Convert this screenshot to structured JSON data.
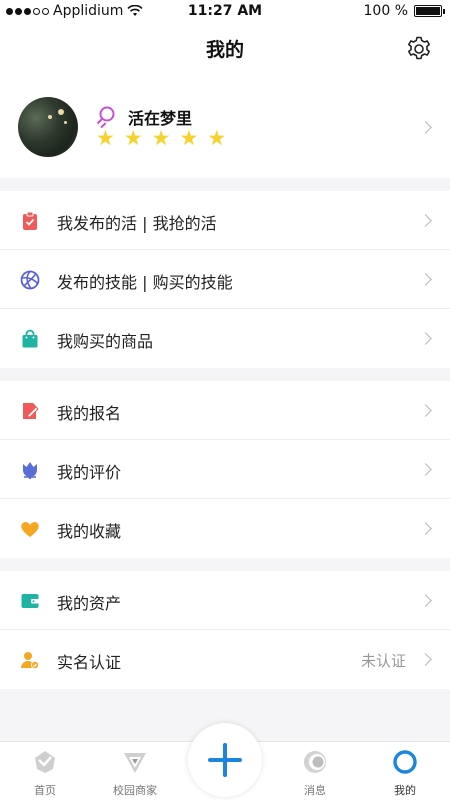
{
  "status_bar": {
    "carrier": "Applidium",
    "time": "11:27 AM",
    "battery": "100 %"
  },
  "header": {
    "title": "我的"
  },
  "profile": {
    "username": "活在梦里",
    "rating": 5,
    "stars": [
      "★",
      "★",
      "★",
      "★",
      "★"
    ]
  },
  "groups": [
    {
      "items": [
        {
          "label": "我发布的活 | 我抢的活",
          "icon": "clipboard-check-icon",
          "color": "#f05a5a"
        },
        {
          "label": "发布的技能 | 购买的技能",
          "icon": "volleyball-icon",
          "color": "#5a5fd6"
        },
        {
          "label": "我购买的商品",
          "icon": "shopping-bag-icon",
          "color": "#1fb3a4"
        }
      ]
    },
    {
      "items": [
        {
          "label": "我的报名",
          "icon": "signup-form-icon",
          "color": "#f05a5a"
        },
        {
          "label": "我的评价",
          "icon": "tulip-icon",
          "color": "#5a6fd6"
        },
        {
          "label": "我的收藏",
          "icon": "heart-icon",
          "color": "#f6a623"
        }
      ]
    },
    {
      "items": [
        {
          "label": "我的资产",
          "icon": "wallet-icon",
          "color": "#1fb3a4"
        },
        {
          "label": "实名认证",
          "icon": "user-verified-icon",
          "color": "#f6a623",
          "status": "未认证"
        }
      ]
    }
  ],
  "tabbar": {
    "tabs": [
      {
        "label": "首页",
        "icon": "home-pin-icon"
      },
      {
        "label": "校园商家",
        "icon": "merchant-logo-icon"
      },
      {
        "label": "",
        "icon": "plus-icon"
      },
      {
        "label": "消息",
        "icon": "message-icon"
      },
      {
        "label": "我的",
        "icon": "profile-ring-icon",
        "active": true
      }
    ]
  },
  "colors": {
    "accent": "#1a86e0",
    "star": "#f6d22d",
    "female": "#c84fd8"
  }
}
